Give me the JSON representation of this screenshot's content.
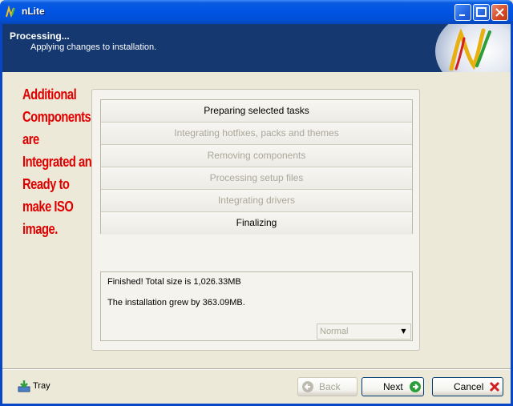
{
  "window": {
    "title": "nLite"
  },
  "header": {
    "title": "Processing...",
    "subtitle": "Applying changes to installation."
  },
  "annotation": [
    "Additional",
    "Components",
    "are",
    "Integrated and",
    "Ready to",
    "make ISO",
    "image."
  ],
  "tasks": [
    {
      "label": "Preparing selected tasks",
      "state": "active"
    },
    {
      "label": "Integrating hotfixes, packs and themes",
      "state": "disabled"
    },
    {
      "label": "Removing components",
      "state": "disabled"
    },
    {
      "label": "Processing setup files",
      "state": "disabled"
    },
    {
      "label": "Integrating drivers",
      "state": "disabled"
    },
    {
      "label": "Finalizing",
      "state": "active"
    }
  ],
  "log": {
    "line1": "Finished! Total size is 1,026.33MB",
    "line2": "The installation grew by 363.09MB."
  },
  "priority_select": {
    "value": "Normal"
  },
  "footer": {
    "tray_label": "Tray",
    "back_label": "Back",
    "next_label": "Next",
    "cancel_label": "Cancel"
  },
  "colors": {
    "annotation": "#e00000",
    "header_bg": "#14386f",
    "titlebar": "#0054e3"
  }
}
